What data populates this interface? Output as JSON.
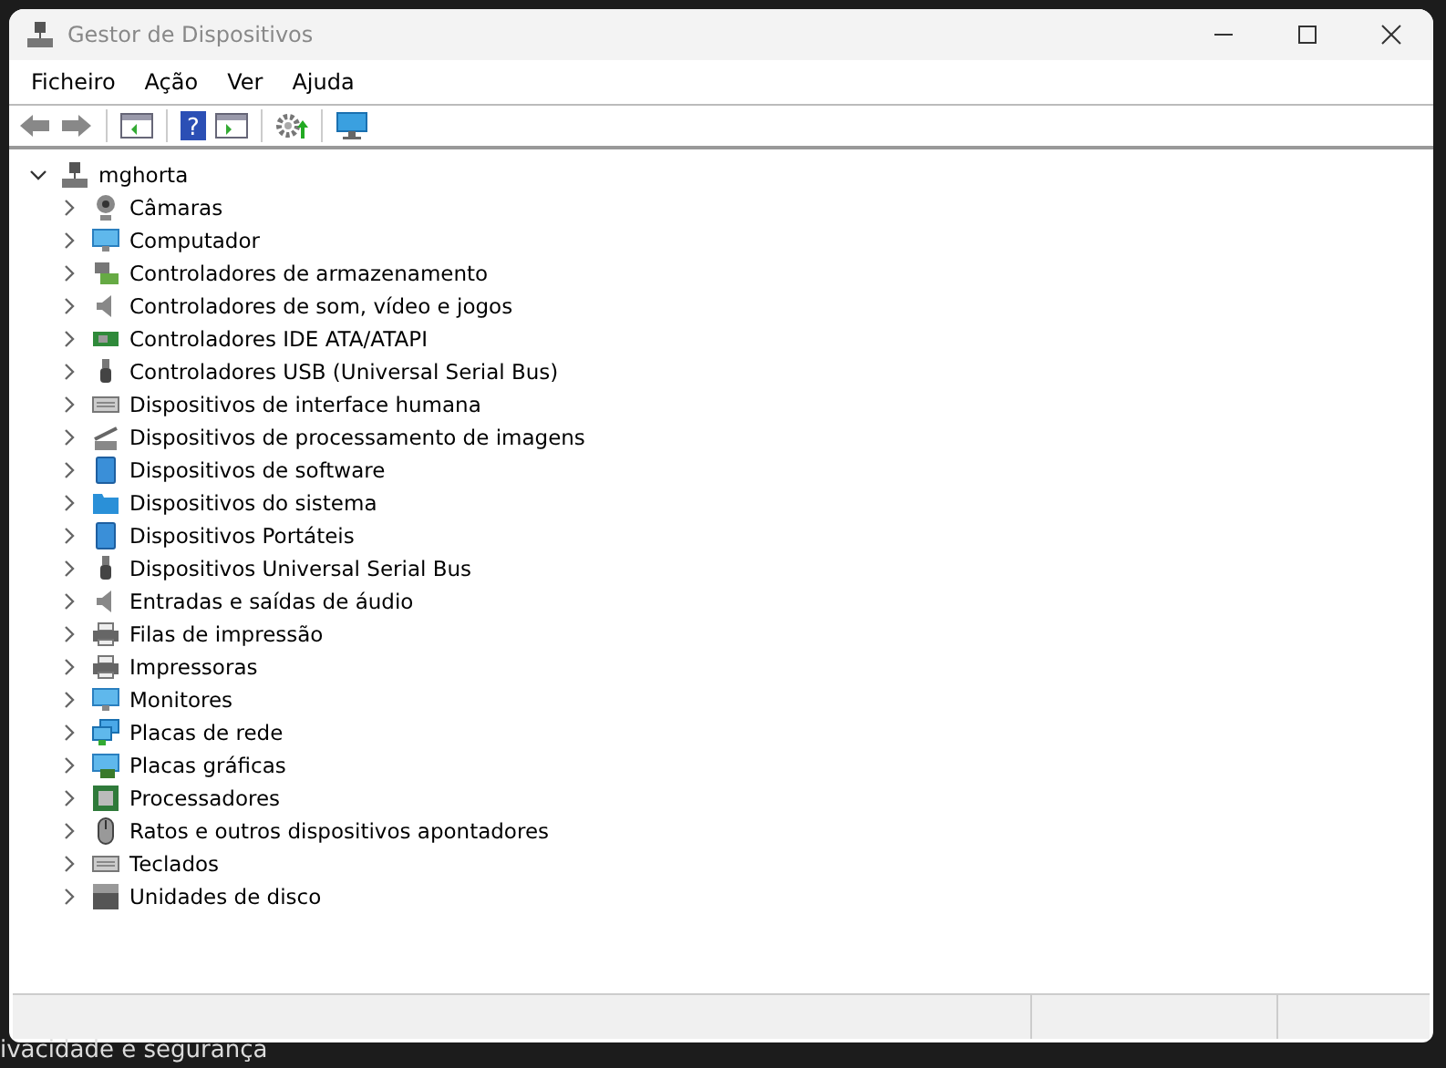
{
  "window": {
    "title": "Gestor de Dispositivos"
  },
  "menu": [
    "Ficheiro",
    "Ação",
    "Ver",
    "Ajuda"
  ],
  "toolbar": {
    "help_glyph": "?"
  },
  "tree": {
    "label": "mghorta",
    "expanded": true,
    "children": [
      {
        "label": "Câmaras",
        "expanded": false
      },
      {
        "label": "Computador",
        "expanded": false
      },
      {
        "label": "Controladores de armazenamento",
        "expanded": false
      },
      {
        "label": "Controladores de som, vídeo e jogos",
        "expanded": false
      },
      {
        "label": "Controladores IDE ATA/ATAPI",
        "expanded": false
      },
      {
        "label": "Controladores USB (Universal Serial Bus)",
        "expanded": false
      },
      {
        "label": "Dispositivos de interface humana",
        "expanded": false
      },
      {
        "label": "Dispositivos de processamento de imagens",
        "expanded": false
      },
      {
        "label": "Dispositivos de software",
        "expanded": false
      },
      {
        "label": "Dispositivos do sistema",
        "expanded": false
      },
      {
        "label": "Dispositivos Portáteis",
        "expanded": false
      },
      {
        "label": "Dispositivos Universal Serial Bus",
        "expanded": false
      },
      {
        "label": "Entradas e saídas de áudio",
        "expanded": false
      },
      {
        "label": "Filas de impressão",
        "expanded": false
      },
      {
        "label": "Impressoras",
        "expanded": false
      },
      {
        "label": "Monitores",
        "expanded": false
      },
      {
        "label": "Placas de rede",
        "expanded": false
      },
      {
        "label": "Placas gráficas",
        "expanded": false
      },
      {
        "label": "Processadores",
        "expanded": false
      },
      {
        "label": "Ratos e outros dispositivos apontadores",
        "expanded": false
      },
      {
        "label": "Teclados",
        "expanded": false
      },
      {
        "label": "Unidades de disco",
        "expanded": false
      }
    ]
  },
  "background_text": "ivacidade e segurança"
}
